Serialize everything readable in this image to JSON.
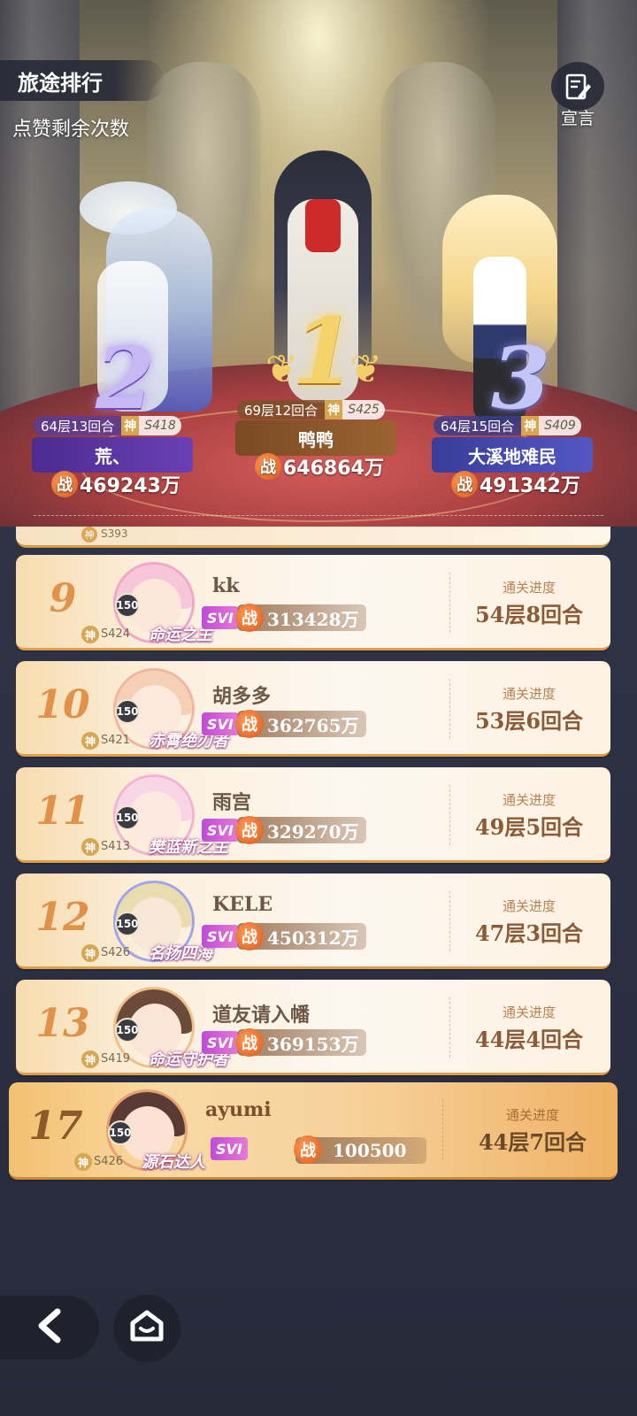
{
  "header": {
    "title": "旅途排行",
    "likes_remaining_label": "点赞剩余次数",
    "declare_label": "宣言"
  },
  "podium": [
    {
      "place": "1",
      "progress": "69层12回合",
      "god_tag": "神",
      "server": "S425",
      "name": "鸭鸭",
      "power_label": "战",
      "power": "646864万"
    },
    {
      "place": "2",
      "progress": "64层13回合",
      "god_tag": "神",
      "server": "S418",
      "name": "荒、",
      "power_label": "战",
      "power": "469243万"
    },
    {
      "place": "3",
      "progress": "64层15回合",
      "god_tag": "神",
      "server": "S409",
      "name": "大溪地难民",
      "power_label": "战",
      "power": "491342万"
    }
  ],
  "partial_row": {
    "god_tag": "神",
    "server": "S393"
  },
  "progress_label": "通关进度",
  "rows": [
    {
      "rank": "9",
      "level": "150",
      "god_tag": "神",
      "server": "S424",
      "title": "命运之主",
      "name": "kk",
      "vip": "SVI",
      "power_label": "战",
      "power": "313428万",
      "progress": "54层8回合",
      "accent": "#f2a7c8"
    },
    {
      "rank": "10",
      "level": "150",
      "god_tag": "神",
      "server": "S421",
      "title": "赤霄绝刃者",
      "name": "胡多多",
      "vip": "SVI",
      "power_label": "战",
      "power": "362765万",
      "progress": "53层6回合",
      "accent": "#f1b5a0"
    },
    {
      "rank": "11",
      "level": "150",
      "god_tag": "神",
      "server": "S413",
      "title": "樊蓝新之主",
      "name": "雨宫",
      "vip": "SVI",
      "power_label": "战",
      "power": "329270万",
      "progress": "49层5回合",
      "accent": "#f3b3d6"
    },
    {
      "rank": "12",
      "level": "150",
      "god_tag": "神",
      "server": "S426",
      "title": "名扬四海",
      "name": "KELE",
      "vip": "SVI",
      "power_label": "战",
      "power": "450312万",
      "progress": "47层3回合",
      "accent": "#9fa5e8"
    },
    {
      "rank": "13",
      "level": "150",
      "god_tag": "神",
      "server": "S419",
      "title": "命运守护者",
      "name": "道友请入幡",
      "vip": "SVI",
      "power_label": "战",
      "power": "369153万",
      "progress": "44层4回合",
      "accent": "#f0c08a"
    }
  ],
  "my_row": {
    "rank": "17",
    "level": "150",
    "god_tag": "神",
    "server": "S426",
    "title": "源石达人",
    "name": "ayumi",
    "vip": "SVI",
    "power_label": "战",
    "power": "100500",
    "progress": "44层7回合",
    "accent": "#e8a070"
  },
  "colors": {
    "card_border": "#dca04c",
    "rank_text": "#e0914a",
    "power_icon": "#d85a1d",
    "vip": "#c04bd6"
  },
  "icons": {
    "declare": "edit-note-icon",
    "back": "chevron-left-icon",
    "home": "home-icon"
  }
}
